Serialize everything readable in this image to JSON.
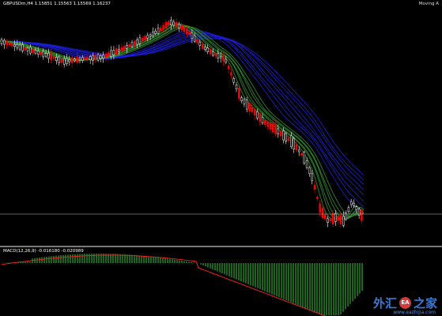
{
  "header": {
    "symbol_info": "GBPUSDm,H4  1.15851 1.15563 1.15569 1.16237",
    "indicator_name": "Moving A"
  },
  "macd": {
    "info": "MACD(12,26,9) -0.016180 -0.020989"
  },
  "watermark": {
    "text_1": "外汇",
    "logo": "EA",
    "text_2": "之家",
    "url": "www.eazhijia.com"
  },
  "colors": {
    "background": "#000000",
    "bull_candle": "#ffffff",
    "bear_candle": "#ff0000",
    "fast_ma": "#2f9e2f",
    "slow_ma": "#1f1fe0",
    "macd_hist": "#33cc33",
    "signal_line": "#ff2020",
    "price_line": "#c8c8c8"
  },
  "chart_data": {
    "type": "candlestick",
    "symbol": "GBPUSDm",
    "timeframe": "H4",
    "ohlc_last": {
      "open": 1.15851,
      "high": 1.15563,
      "low": 1.15569,
      "close": 1.16237
    },
    "indicators": [
      "Moving Average ribbon",
      "MACD(12,26,9)"
    ],
    "macd_values": {
      "main": -0.01618,
      "signal": -0.020989
    }
  }
}
